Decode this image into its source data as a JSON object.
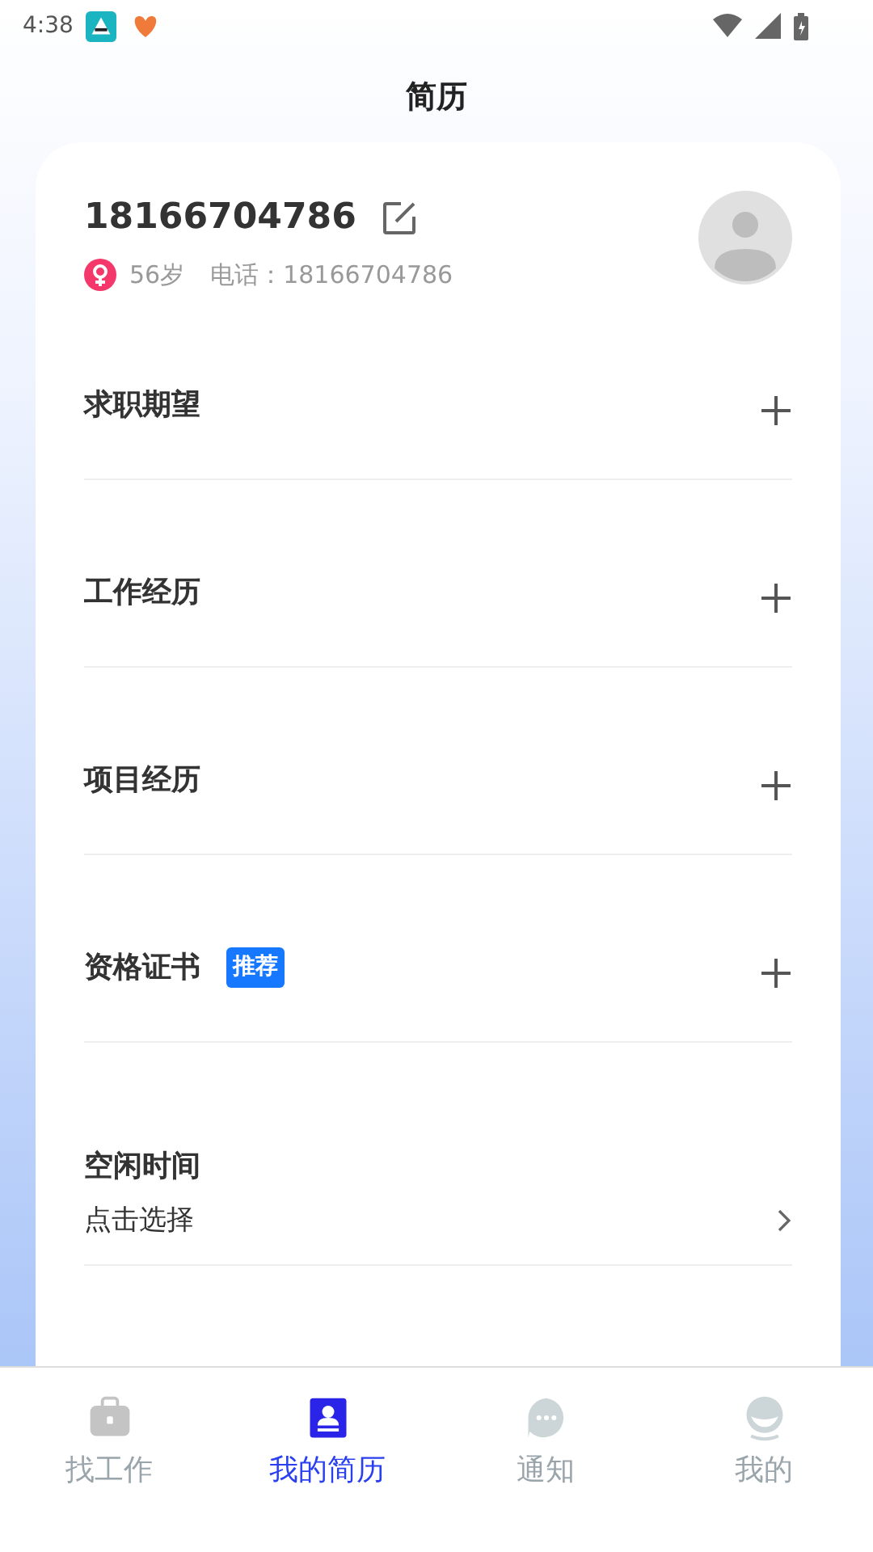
{
  "status_bar": {
    "time": "4:38"
  },
  "title": "简历",
  "profile": {
    "name": "18166704786",
    "age": "56岁",
    "phone": "电话：18166704786"
  },
  "sections": [
    {
      "kind": "add",
      "label": "求职期望"
    },
    {
      "kind": "add",
      "label": "工作经历"
    },
    {
      "kind": "add",
      "label": "项目经历"
    },
    {
      "kind": "add",
      "label": "资格证书",
      "badge": "推荐"
    },
    {
      "kind": "select",
      "label": "空闲时间",
      "value": "点击选择"
    }
  ],
  "tab_bar": [
    {
      "label": "找工作",
      "selected": false
    },
    {
      "label": "我的简历",
      "selected": true
    },
    {
      "label": "通知",
      "selected": false
    },
    {
      "label": "我的",
      "selected": false
    }
  ]
}
